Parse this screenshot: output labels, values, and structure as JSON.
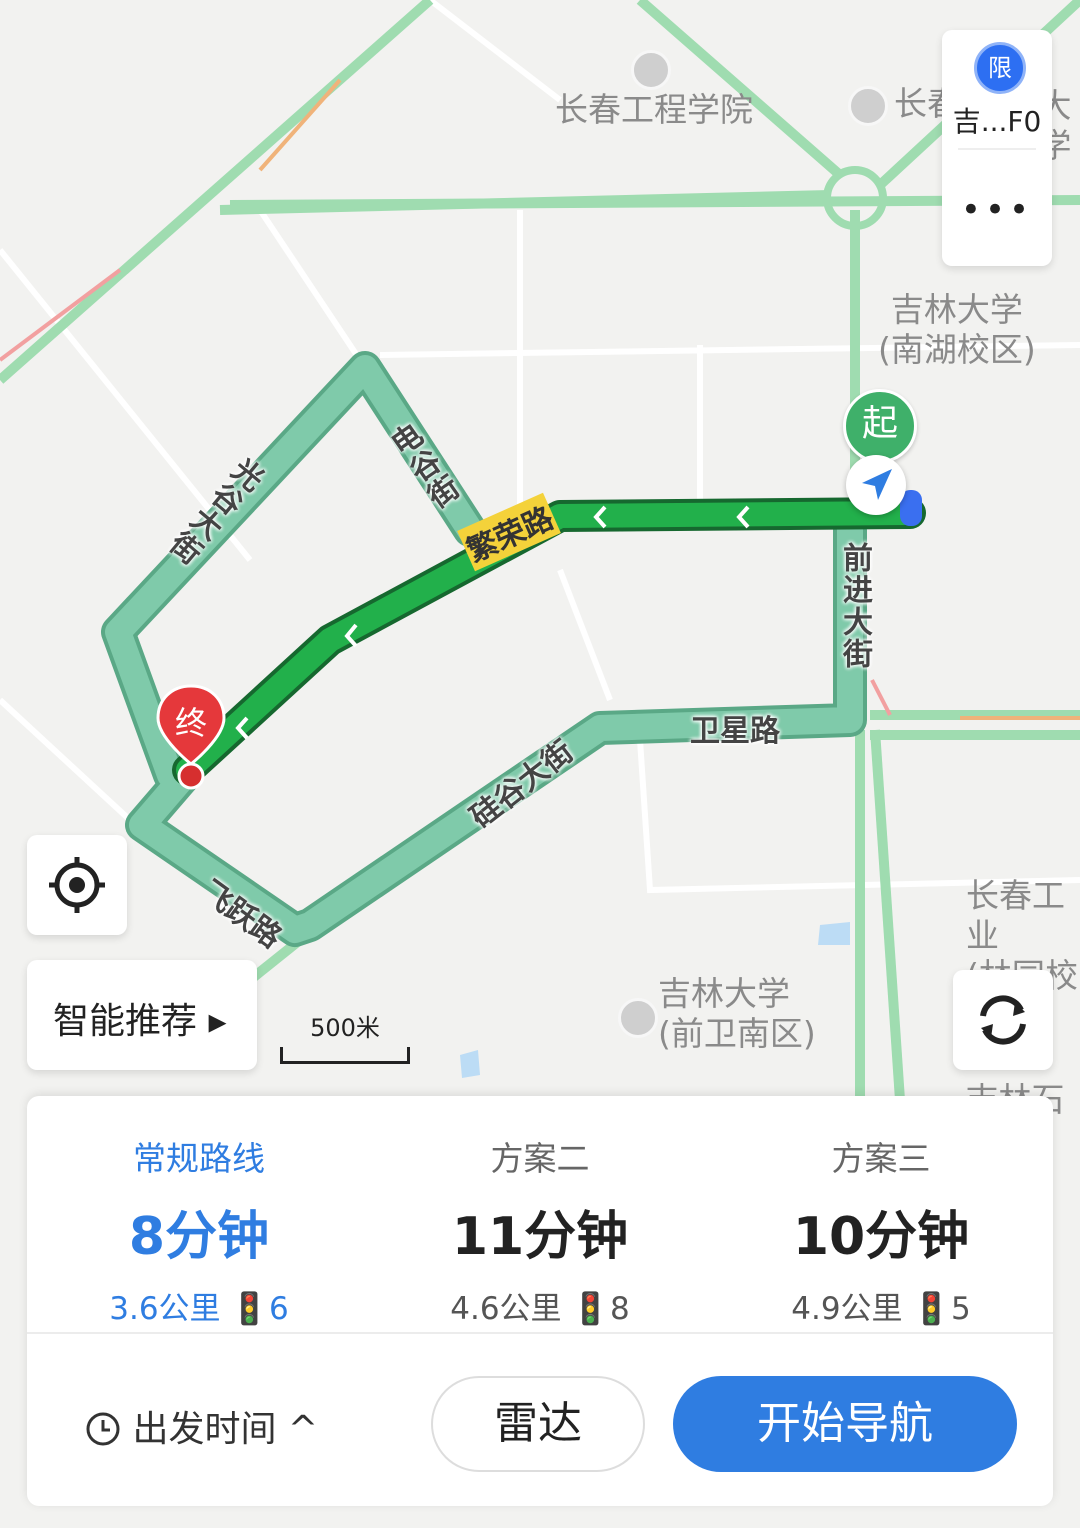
{
  "map": {
    "pois": {
      "changchun_eng_college": "长春工程学院",
      "changchun_top": "长春",
      "daxue_top": "大学",
      "jilin_nanhu": "吉林大学",
      "jilin_nanhu_sub": "(南湖校区)",
      "changchun_gong": "长春工业",
      "changchun_gong_sub": "(林园校",
      "jilin_qianwei": "吉林大学",
      "jilin_qianwei_sub": "(前卫南区)",
      "oil": "石油",
      "oil_prefix": "吉林"
    },
    "roads": {
      "fanrong": "繁荣路",
      "guanggu": "光谷大街",
      "diangu": "电谷街",
      "qianjin": "前进大街",
      "weixing": "卫星路",
      "guigu": "硅谷大街",
      "feiyue": "飞跃路"
    },
    "markers": {
      "start": "起",
      "end": "终"
    },
    "scale": "500米"
  },
  "top_card": {
    "limit_badge": "限",
    "limit_text": "吉...F0",
    "more": "•••"
  },
  "smart_recommend": {
    "label": "智能推荐 ▸"
  },
  "routes": [
    {
      "name": "常规路线",
      "time": "8分钟",
      "meta": "3.6公里 🚦6",
      "active": true
    },
    {
      "name": "方案二",
      "time": "11分钟",
      "meta": "4.6公里 🚦8",
      "active": false
    },
    {
      "name": "方案三",
      "time": "10分钟",
      "meta": "4.9公里 🚦5",
      "active": false
    }
  ],
  "bottom": {
    "depart_time": "出发时间 ^",
    "radar": "雷达",
    "start_nav": "开始导航"
  },
  "colors": {
    "accent": "#2f7de1",
    "route_main": "#1fa84a",
    "route_alt": "#6cc6a0"
  }
}
